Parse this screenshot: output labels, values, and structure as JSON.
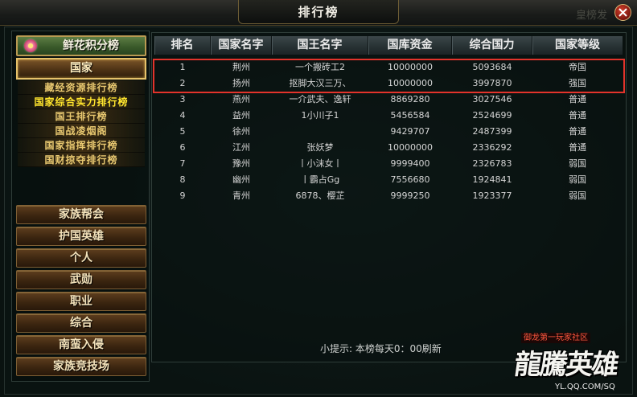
{
  "window": {
    "title": "排行榜",
    "background_text": "皇榜发"
  },
  "close_button": {
    "icon": "close-icon"
  },
  "sidebar": {
    "flower_button": {
      "label": "鲜花积分榜",
      "icon": "flower-icon"
    },
    "active_category": {
      "label": "国家"
    },
    "sub_items": [
      {
        "label": "藏经资源排行榜",
        "selected": false
      },
      {
        "label": "国家综合实力排行榜",
        "selected": true
      },
      {
        "label": "国王排行榜",
        "selected": false
      },
      {
        "label": "国战凌烟阁",
        "selected": false
      },
      {
        "label": "国家指挥排行榜",
        "selected": false
      },
      {
        "label": "国财掠夺排行榜",
        "selected": false
      }
    ],
    "categories": [
      {
        "label": "家族帮会"
      },
      {
        "label": "护国英雄"
      },
      {
        "label": "个人"
      },
      {
        "label": "武勋"
      },
      {
        "label": "职业"
      },
      {
        "label": "综合"
      },
      {
        "label": "南蛮入侵"
      },
      {
        "label": "家族竞技场"
      }
    ]
  },
  "table": {
    "columns": {
      "rank": "排名",
      "country": "国家名字",
      "king": "国王名字",
      "treasury": "国库资金",
      "power": "综合国力",
      "level": "国家等级"
    },
    "rows": [
      {
        "rank": "1",
        "country": "荆州",
        "king": "一个搬砖工2",
        "treasury": "10000000",
        "power": "5093684",
        "level": "帝国"
      },
      {
        "rank": "2",
        "country": "扬州",
        "king": "抠脚大汉三万、",
        "treasury": "10000000",
        "power": "3997870",
        "level": "强国"
      },
      {
        "rank": "3",
        "country": "燕州",
        "king": "一介武夫、逸轩",
        "treasury": "8869280",
        "power": "3027546",
        "level": "普通"
      },
      {
        "rank": "4",
        "country": "益州",
        "king": "1小川子1",
        "treasury": "5456584",
        "power": "2524699",
        "level": "普通"
      },
      {
        "rank": "5",
        "country": "徐州",
        "king": "",
        "treasury": "9429707",
        "power": "2487399",
        "level": "普通"
      },
      {
        "rank": "6",
        "country": "江州",
        "king": "张妖梦",
        "treasury": "10000000",
        "power": "2336292",
        "level": "普通"
      },
      {
        "rank": "7",
        "country": "豫州",
        "king": "丨小沫女丨",
        "treasury": "9999400",
        "power": "2326783",
        "level": "弱国"
      },
      {
        "rank": "8",
        "country": "幽州",
        "king": "丨霸占Gg",
        "treasury": "7556680",
        "power": "1924841",
        "level": "弱国"
      },
      {
        "rank": "9",
        "country": "青州",
        "king": "6878、樱芷",
        "treasury": "9999250",
        "power": "1923377",
        "level": "弱国"
      }
    ],
    "highlight": {
      "ranks": [
        1,
        2
      ],
      "color": "#e3332b"
    }
  },
  "tip": "小提示: 本榜每天0：00刷新",
  "logo": {
    "badge": "御龙第一玩家社区",
    "title": "龍騰英雄",
    "url": "YL.QQ.COM/SQ"
  },
  "colors": {
    "selected_sub_item": "#ffe52e",
    "sub_item": "#e8c870",
    "button_text": "#f4e3bb",
    "table_text": "#d4d4d4",
    "header_text": "#ececec"
  }
}
